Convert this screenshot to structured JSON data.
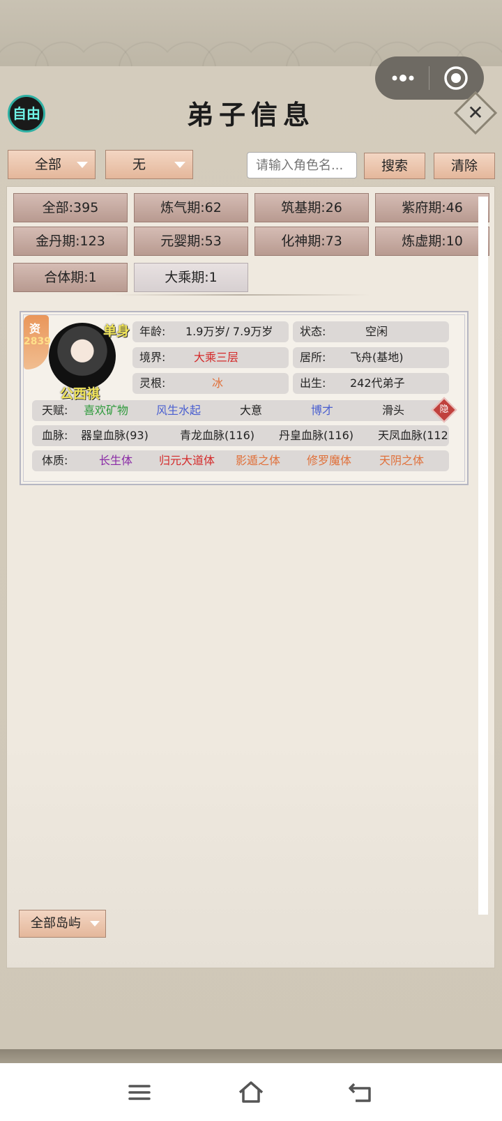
{
  "header": {
    "title": "弟子信息",
    "auto_label": "自由",
    "close_label": "✕"
  },
  "filters": {
    "category": "全部",
    "subfilter": "无",
    "search_placeholder": "请输入角色名...",
    "search_label": "搜索",
    "clear_label": "清除"
  },
  "realm_tabs": [
    {
      "label": "全部:395",
      "active": false
    },
    {
      "label": "炼气期:62",
      "active": false
    },
    {
      "label": "筑基期:26",
      "active": false
    },
    {
      "label": "紫府期:46",
      "active": false
    },
    {
      "label": "金丹期:123",
      "active": false
    },
    {
      "label": "元婴期:53",
      "active": false
    },
    {
      "label": "化神期:73",
      "active": false
    },
    {
      "label": "炼虚期:10",
      "active": false
    },
    {
      "label": "合体期:1",
      "active": false
    },
    {
      "label": "大乘期:1",
      "active": true
    }
  ],
  "disciple": {
    "aptitude_label": "资",
    "aptitude_value": "2839",
    "marital": "单身",
    "name": "公西祺",
    "age_key": "年龄:",
    "age_val": "1.9万岁/ 7.9万岁",
    "status_key": "状态:",
    "status_val": "空闲",
    "realm_key": "境界:",
    "realm_val": "大乘三层",
    "residence_key": "居所:",
    "residence_val": "飞舟(基地)",
    "root_key": "灵根:",
    "root_val": "冰",
    "origin_key": "出生:",
    "origin_val": "242代弟子",
    "talent_key": "天赋:",
    "talents": [
      {
        "text": "喜欢矿物",
        "color": "#2e9a3c"
      },
      {
        "text": "风生水起",
        "color": "#4a5fd0"
      },
      {
        "text": "大意",
        "color": "#222222"
      },
      {
        "text": "博才",
        "color": "#4a5fd0"
      },
      {
        "text": "滑头",
        "color": "#222222"
      }
    ],
    "hide_label": "隐",
    "bloodline_key": "血脉:",
    "bloodlines": [
      "器皇血脉(93)",
      "青龙血脉(116)",
      "丹皇血脉(116)",
      "天凤血脉(112"
    ],
    "physique_key": "体质:",
    "physiques": [
      {
        "text": "长生体",
        "color": "#8a2aa6"
      },
      {
        "text": "归元大道体",
        "color": "#d42a2a"
      },
      {
        "text": "影遁之体",
        "color": "#e0703a"
      },
      {
        "text": "修罗魔体",
        "color": "#e0703a"
      },
      {
        "text": "天阴之体",
        "color": "#e0703a"
      }
    ]
  },
  "island_filter": "全部岛屿",
  "colors": {
    "realm_val": "#d42a2a",
    "root_val": "#e0703a"
  }
}
